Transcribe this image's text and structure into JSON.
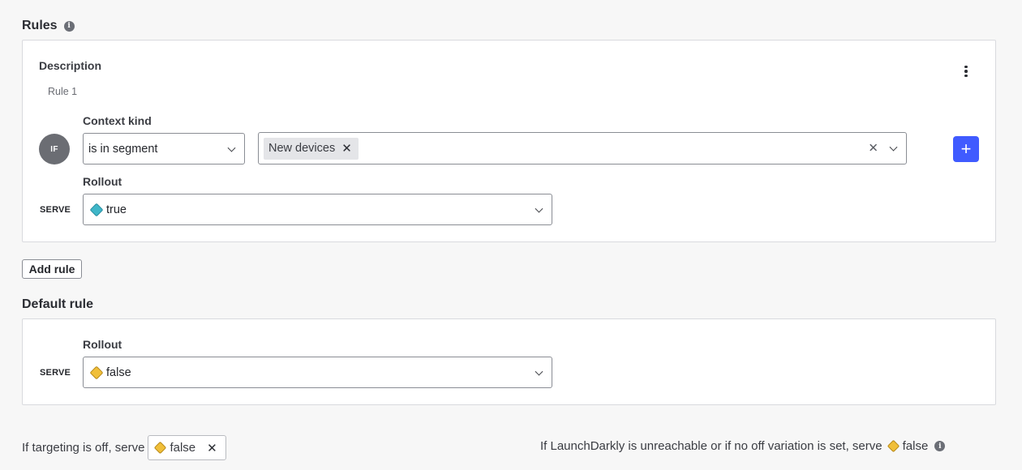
{
  "rules": {
    "title": "Rules",
    "info_icon": "info-icon",
    "card": {
      "description_label": "Description",
      "rule_name": "Rule 1",
      "menu_icon": "kebab-menu-icon",
      "if_badge": "IF",
      "context_kind_label": "Context kind",
      "operator": "is in segment",
      "segments": [
        {
          "label": "New devices"
        }
      ],
      "add_clause_icon": "plus-icon",
      "rollout_label": "Rollout",
      "serve_label": "SERVE",
      "serve_value": "true",
      "serve_color": "#3fb6c8"
    },
    "add_rule_label": "Add rule"
  },
  "default_rule": {
    "title": "Default rule",
    "rollout_label": "Rollout",
    "serve_label": "SERVE",
    "serve_value": "false",
    "serve_color": "#f0bf3a"
  },
  "footer": {
    "off_text": "If targeting is off, serve",
    "off_value": "false",
    "off_color": "#f0bf3a",
    "unreachable_text": "If LaunchDarkly is unreachable or if no off variation is set, serve",
    "unreachable_value": "false",
    "unreachable_color": "#f0bf3a"
  }
}
